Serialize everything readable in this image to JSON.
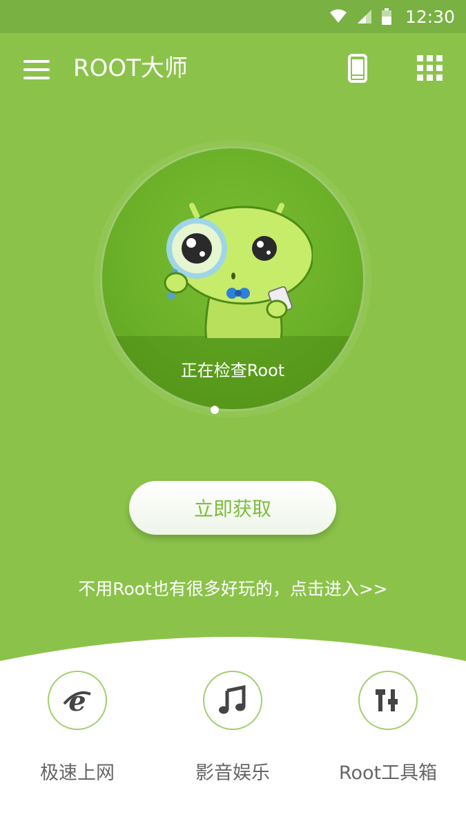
{
  "status_bar": {
    "time": "12:30"
  },
  "app_bar": {
    "title": "ROOT大师"
  },
  "main": {
    "checking_text": "正在检查Root",
    "get_button_label": "立即获取",
    "promo_link": "不用Root也有很多好玩的，点击进入>>"
  },
  "tools": [
    {
      "label": "极速上网",
      "icon": "browser-e-icon"
    },
    {
      "label": "影音娱乐",
      "icon": "music-note-icon"
    },
    {
      "label": "Root工具箱",
      "icon": "tools-icon"
    }
  ],
  "colors": {
    "primary": "#8bc34a",
    "status_bar": "#79b142",
    "button_text": "#7cbc3e",
    "icon_ring": "#9fd06f"
  }
}
